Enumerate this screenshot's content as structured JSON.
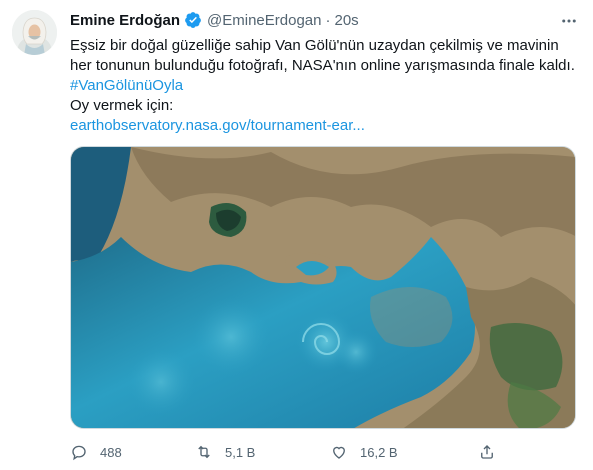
{
  "tweet": {
    "author_name": "Emine Erdoğan",
    "handle": "@EmineErdogan",
    "separator": "·",
    "time": "20s",
    "text_line1": "Eşsiz bir doğal güzelliğe sahip Van Gölü'nün uzaydan çekilmiş ve mavinin",
    "text_line2": "her tonunun bulunduğu fotoğrafı, NASA'nın online yarışmasında finale kaldı.",
    "hashtag": "#VanGölünüOyla",
    "vote_label": "Oy vermek için:",
    "url": "earthobservatory.nasa.gov/tournament-ear..."
  },
  "actions": {
    "replies": "488",
    "retweets": "5,1 B",
    "likes": "16,2 B"
  },
  "icons": {
    "verified": "verified-badge-icon",
    "more": "more-options-icon",
    "reply": "reply-icon",
    "retweet": "retweet-icon",
    "like": "like-icon",
    "share": "share-icon"
  },
  "colors": {
    "link": "#1b95e0",
    "verified": "#1d9bf0",
    "muted": "#536471",
    "lake_blue": "#2fa7c9",
    "land_tan": "#9a8564"
  }
}
